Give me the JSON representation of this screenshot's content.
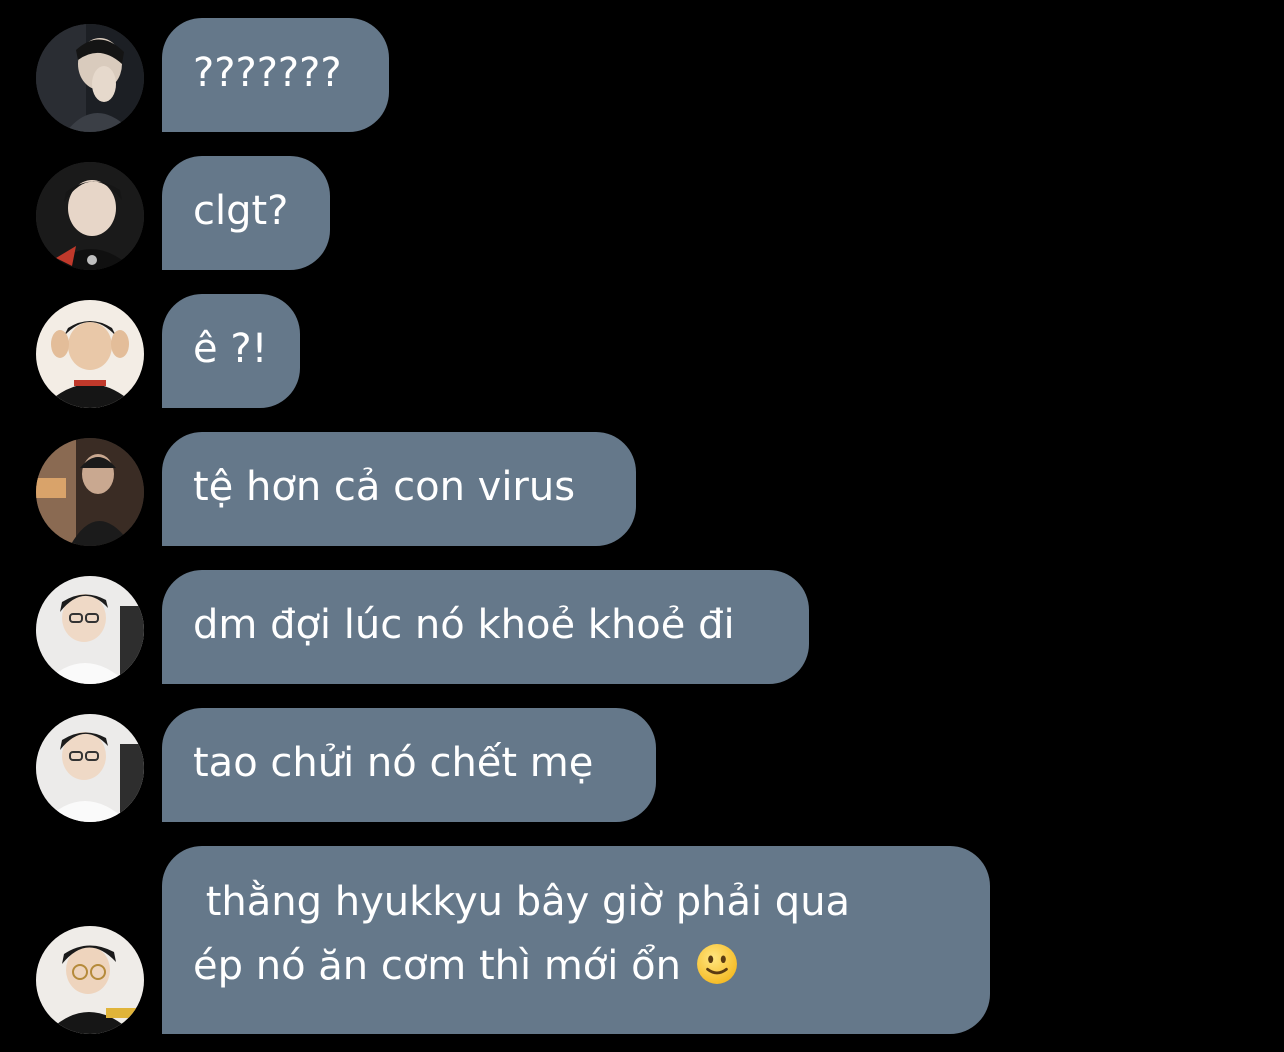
{
  "colors": {
    "background": "#000000",
    "bubble": "#65788a",
    "text": "#ffffff"
  },
  "messages": [
    {
      "avatar": "avatar-1",
      "text": "???????"
    },
    {
      "avatar": "avatar-2",
      "text": "clgt?"
    },
    {
      "avatar": "avatar-3",
      "text": "ê ?!"
    },
    {
      "avatar": "avatar-4",
      "text": "tệ hơn cả con virus"
    },
    {
      "avatar": "avatar-5",
      "text": "dm đợi lúc nó khoẻ khoẻ đi"
    },
    {
      "avatar": "avatar-5",
      "text": "tao chửi nó chết mẹ"
    },
    {
      "avatar": "avatar-6",
      "line1": " thằng hyukkyu bây giờ phải qua",
      "line2": "ép nó ăn cơm thì mới ổn ",
      "emoji": "slightly-smiling-face-emoji"
    }
  ]
}
